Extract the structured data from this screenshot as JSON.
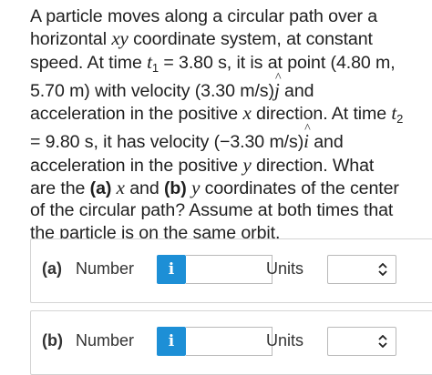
{
  "question": {
    "p1": "A particle moves along a circular path over a horizontal ",
    "xy": "xy",
    "p2": " coordinate system, at constant speed. At time ",
    "t": "t",
    "sub1": "1",
    "p3": " = 3.80 s, it is at point (4.80 m, 5.70 m) with velocity (3.30 m/s)",
    "j": "j",
    "p4": " and acceleration in the positive ",
    "x1": "x",
    "p5": " direction. At time ",
    "t2": "t",
    "sub2": "2",
    "p6": " = 9.80 s, it has velocity (−3.30 m/s)",
    "i": "i",
    "p7": " and acceleration in the positive ",
    "y1": "y",
    "p8": " direction. What are the ",
    "a": "(a)",
    "p9": " ",
    "x2": "x",
    "p10": " and ",
    "b": "(b)",
    "p11": " ",
    "y2": "y",
    "p12": " coordinates of the center of the circular path? Assume at both times that the particle is on the same orbit."
  },
  "answers": [
    {
      "part": "(a)",
      "number_label": "Number",
      "info_label": "i",
      "value": "",
      "units_label": "Units",
      "units_value": ""
    },
    {
      "part": "(b)",
      "number_label": "Number",
      "info_label": "i",
      "value": "",
      "units_label": "Units",
      "units_value": ""
    }
  ],
  "icons": {
    "info": "info-icon",
    "select": "chevron-updown-icon"
  },
  "colors": {
    "info_button": "#1d8fd6",
    "border": "#d4d4d4"
  }
}
